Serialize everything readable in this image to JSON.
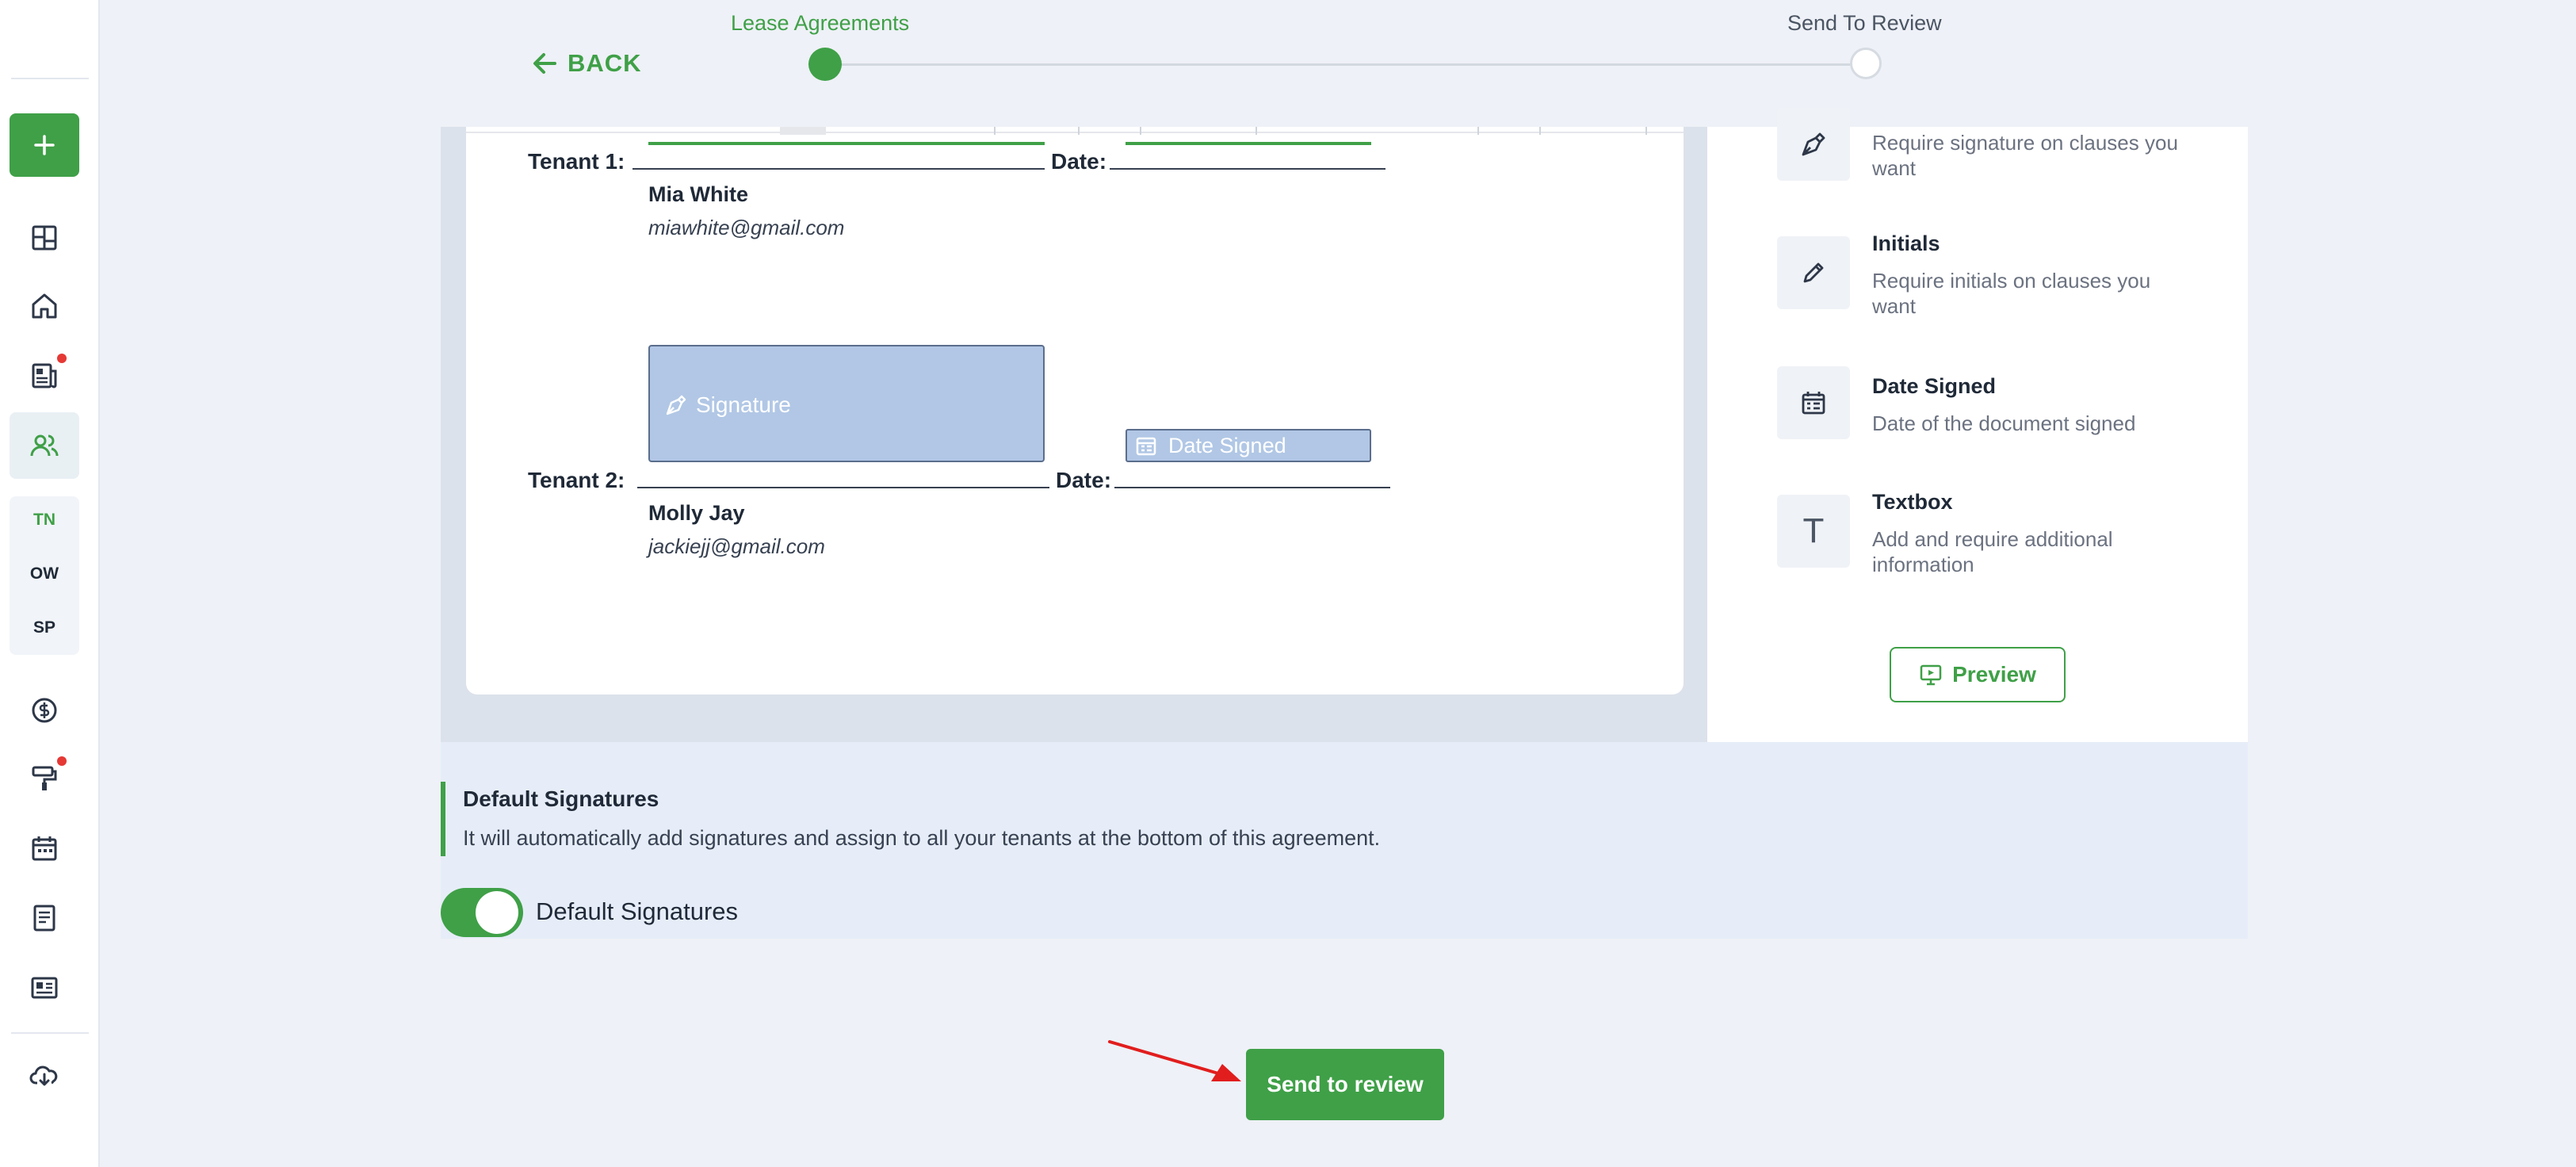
{
  "steps": {
    "back_label": "BACK",
    "step1_label": "Lease Agreements",
    "step2_label": "Send To Review"
  },
  "sidebar": {
    "sub_items": [
      "TN",
      "OW",
      "SP"
    ]
  },
  "document": {
    "tenant1": {
      "label": "Tenant 1:",
      "date_label": "Date:",
      "name": "Mia White",
      "email": "miawhite@gmail.com"
    },
    "tenant2": {
      "label": "Tenant 2:",
      "date_label": "Date:",
      "name": "Molly Jay",
      "email": "jackiejj@gmail.com",
      "signature_field": "Signature",
      "date_field": "Date Signed"
    }
  },
  "fields_panel": {
    "signature_desc": "Require signature on clauses you want",
    "initials_title": "Initials",
    "initials_desc": "Require initials on clauses you want",
    "date_title": "Date Signed",
    "date_desc": "Date of the document signed",
    "textbox_title": "Textbox",
    "textbox_desc": "Add and require additional information",
    "preview_label": "Preview"
  },
  "default_signatures": {
    "title": "Default Signatures",
    "description": "It will automatically add signatures and assign to all your tenants at the bottom of this agreement.",
    "toggle_label": "Default Signatures",
    "toggle_on": true
  },
  "send_button_label": "Send to review",
  "colors": {
    "accent": "#3fa047",
    "signature_fill": "#b1c7e5",
    "notification": "#e53935"
  }
}
